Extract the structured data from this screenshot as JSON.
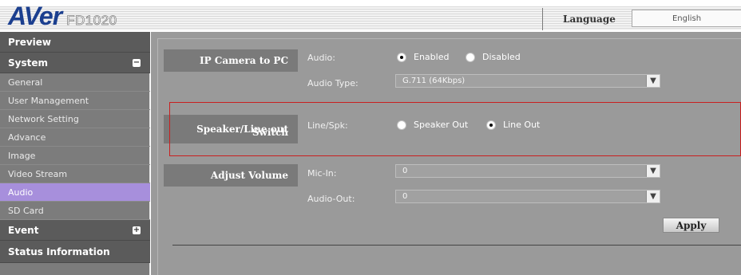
{
  "header": {
    "brand": "AVer",
    "model": "FD1020",
    "language_label": "Language",
    "language_value": "English"
  },
  "sidebar": {
    "preview": "Preview",
    "system": "System",
    "system_toggle": "−",
    "system_items": [
      "General",
      "User Management",
      "Network Setting",
      "Advance",
      "Image",
      "Video Stream",
      "Audio",
      "SD Card"
    ],
    "active_item": "Audio",
    "event": "Event",
    "event_toggle": "+",
    "status": "Status Information"
  },
  "main": {
    "ip_camera": {
      "title": "IP Camera to PC",
      "audio_label": "Audio:",
      "audio_options": [
        "Enabled",
        "Disabled"
      ],
      "audio_selected": "Enabled",
      "audio_type_label": "Audio Type:",
      "audio_type_value": "G.711 (64Kbps)"
    },
    "speaker": {
      "title_line1": "Speaker/Line out",
      "title_line2": "Switch",
      "linespk_label": "Line/Spk:",
      "options": [
        "Speaker Out",
        "Line Out"
      ],
      "selected": "Line Out"
    },
    "volume": {
      "title": "Adjust Volume",
      "mic_label": "Mic-In:",
      "mic_value": "0",
      "audio_out_label": "Audio-Out:",
      "audio_out_value": "0"
    },
    "apply_label": "Apply"
  },
  "colors": {
    "brand_blue": "#1b3f8f",
    "active_item": "#a78fdc",
    "highlight_red": "#c92020"
  },
  "icons": {
    "select_arrow": "chevron-down-icon",
    "collapse": "minus-icon",
    "expand": "plus-icon"
  }
}
